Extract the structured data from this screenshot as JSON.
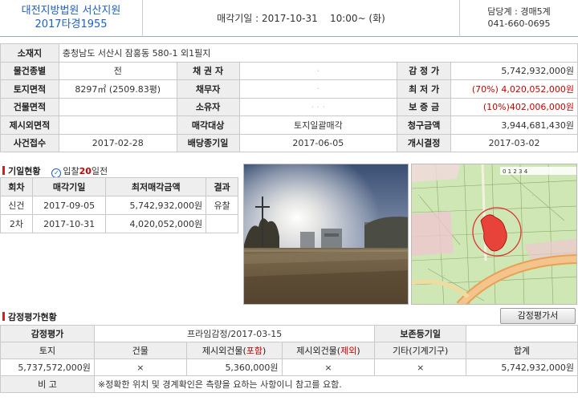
{
  "header": {
    "court_name": "대전지방법원 서산지원",
    "case_no": "2017타경1955",
    "sale_date_label": "매각기일 : 2017-10-31",
    "sale_time": "10:00~ (화)",
    "dept_label": "담당계 : 경매5계",
    "dept_phone": "041-660-0695"
  },
  "info": {
    "location_label": "소재지",
    "location_value": "충청남도 서산시 잠홍동 580-1 외1필지",
    "land_type_label": "물건종별",
    "land_type_value": "전",
    "creditor_label": "채 권 자",
    "appraisal_label": "감 정 가",
    "appraisal_value": "5,742,932,000원",
    "land_area_label": "토지면적",
    "land_area_value": "8297㎡ (2509.83평)",
    "debtor_label": "채무자",
    "min_price_label": "최 저 가",
    "min_price_value": "(70%) 4,020,052,000원",
    "building_area_label": "건물면적",
    "owner_label": "소유자",
    "deposit_label": "보 증 금",
    "deposit_value": "(10%)402,006,000원",
    "excluded_area_label": "제시외면적",
    "sale_target_label": "매각대상",
    "sale_target_value": "토지일괄매각",
    "claim_label": "청구금액",
    "claim_value": "3,944,681,430원",
    "case_received_label": "사건접수",
    "case_received_value": "2017-02-28",
    "dividend_deadline_label": "배당종기일",
    "dividend_deadline_value": "2017-06-05",
    "start_decision_label": "개시결정",
    "start_decision_value": "2017-03-02"
  },
  "history": {
    "title": "기일현황",
    "inhal_prefix": "입찰",
    "inhal_days": "20",
    "inhal_suffix": "일전",
    "headers": [
      "회차",
      "매각기일",
      "최저매각금액",
      "결과"
    ],
    "rows": [
      {
        "round": "신건",
        "date": "2017-09-05",
        "amount": "5,742,932,000원",
        "result": "유찰"
      },
      {
        "round": "2차",
        "date": "2017-10-31",
        "amount": "4,020,052,000원",
        "result": ""
      }
    ]
  },
  "appraisal": {
    "title": "감정평가현황",
    "button_label": "감정평가서",
    "org_label": "감정평가",
    "org_value": "프라임감정/2017-03-15",
    "preserve_label": "보존등기일",
    "col_land": "토지",
    "col_building": "건물",
    "col_excl_in_prefix": "제시외건물(",
    "col_excl_in_mark": "포함",
    "col_excl_out_prefix": "제시외건물(",
    "col_excl_out_mark": "제외",
    "col_suffix": ")",
    "col_other": "기타(기계기구)",
    "col_total": "합계",
    "val_land": "5,737,572,000원",
    "val_building": "×",
    "val_excl_in": "5,360,000원",
    "val_excl_out": "×",
    "val_other": "×",
    "val_total": "5,742,932,000원",
    "note_label": "비 고",
    "note_value": "※정확한 위치 및 경계확인은 측량을 요하는 사항이니 참고를 요함."
  },
  "map": {
    "scale_text": "0 1 2 3 4"
  },
  "colors": {
    "accent_blue": "#1f5fc1",
    "accent_red": "#c00000"
  }
}
